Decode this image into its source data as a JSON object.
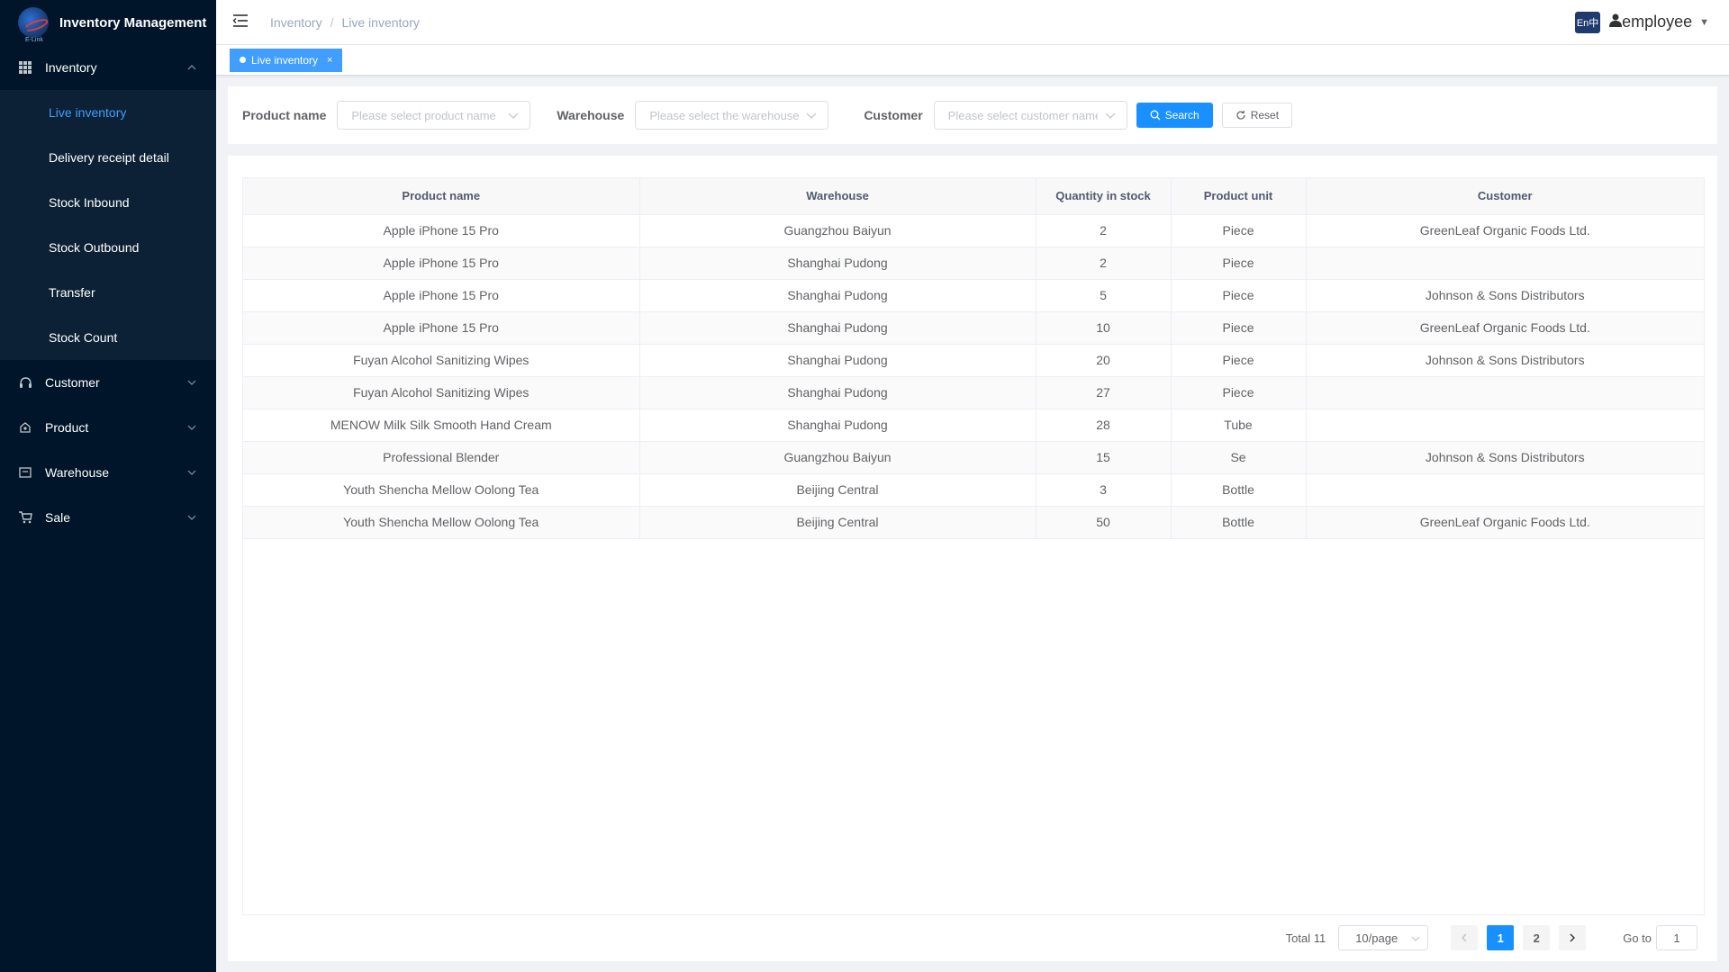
{
  "app": {
    "title": "Inventory Management",
    "logo_subtext": "E-Link"
  },
  "sidebar": {
    "groups": [
      {
        "label": "Inventory",
        "icon": "grid-icon",
        "expanded": true,
        "children": [
          {
            "label": "Live inventory",
            "active": true
          },
          {
            "label": "Delivery receipt detail"
          },
          {
            "label": "Stock Inbound"
          },
          {
            "label": "Stock Outbound"
          },
          {
            "label": "Transfer"
          },
          {
            "label": "Stock Count"
          }
        ]
      },
      {
        "label": "Customer",
        "icon": "customer-icon",
        "expanded": false
      },
      {
        "label": "Product",
        "icon": "product-icon",
        "expanded": false
      },
      {
        "label": "Warehouse",
        "icon": "warehouse-icon",
        "expanded": false
      },
      {
        "label": "Sale",
        "icon": "cart-icon",
        "expanded": false
      }
    ]
  },
  "header": {
    "breadcrumb": [
      "Inventory",
      "Live inventory"
    ],
    "lang_label": "En中",
    "user_name": "employee"
  },
  "tags": {
    "active_tag": "Live inventory",
    "close_glyph": "×"
  },
  "filters": {
    "product": {
      "label": "Product name",
      "placeholder": "Please select product name"
    },
    "warehouse": {
      "label": "Warehouse",
      "placeholder": "Please select the warehouse"
    },
    "customer": {
      "label": "Customer",
      "placeholder": "Please select customer name"
    },
    "search_label": "Search",
    "reset_label": "Reset"
  },
  "table": {
    "columns": [
      "Product name",
      "Warehouse",
      "Quantity in stock",
      "Product unit",
      "Customer"
    ],
    "rows": [
      [
        "Apple iPhone 15 Pro",
        "Guangzhou Baiyun",
        "2",
        "Piece",
        "GreenLeaf Organic Foods Ltd."
      ],
      [
        "Apple iPhone 15 Pro",
        "Shanghai Pudong",
        "2",
        "Piece",
        ""
      ],
      [
        "Apple iPhone 15 Pro",
        "Shanghai Pudong",
        "5",
        "Piece",
        "Johnson & Sons Distributors"
      ],
      [
        "Apple iPhone 15 Pro",
        "Shanghai Pudong",
        "10",
        "Piece",
        "GreenLeaf Organic Foods Ltd."
      ],
      [
        "Fuyan Alcohol Sanitizing Wipes",
        "Shanghai Pudong",
        "20",
        "Piece",
        "Johnson & Sons Distributors"
      ],
      [
        "Fuyan Alcohol Sanitizing Wipes",
        "Shanghai Pudong",
        "27",
        "Piece",
        ""
      ],
      [
        "MENOW Milk Silk Smooth Hand Cream",
        "Shanghai Pudong",
        "28",
        "Tube",
        ""
      ],
      [
        "Professional Blender",
        "Guangzhou Baiyun",
        "15",
        "Se",
        "Johnson & Sons Distributors"
      ],
      [
        "Youth Shencha Mellow Oolong Tea",
        "Beijing Central",
        "3",
        "Bottle",
        ""
      ],
      [
        "Youth Shencha Mellow Oolong Tea",
        "Beijing Central",
        "50",
        "Bottle",
        "GreenLeaf Organic Foods Ltd."
      ]
    ]
  },
  "pagination": {
    "total_text": "Total 11",
    "page_size": "10/page",
    "pages": [
      "1",
      "2"
    ],
    "current_page": "1",
    "goto_label": "Go to",
    "goto_value": "1"
  },
  "colors": {
    "sidebar_bg": "#001529",
    "accent": "#1890ff",
    "active_menu_text": "#409eff"
  }
}
